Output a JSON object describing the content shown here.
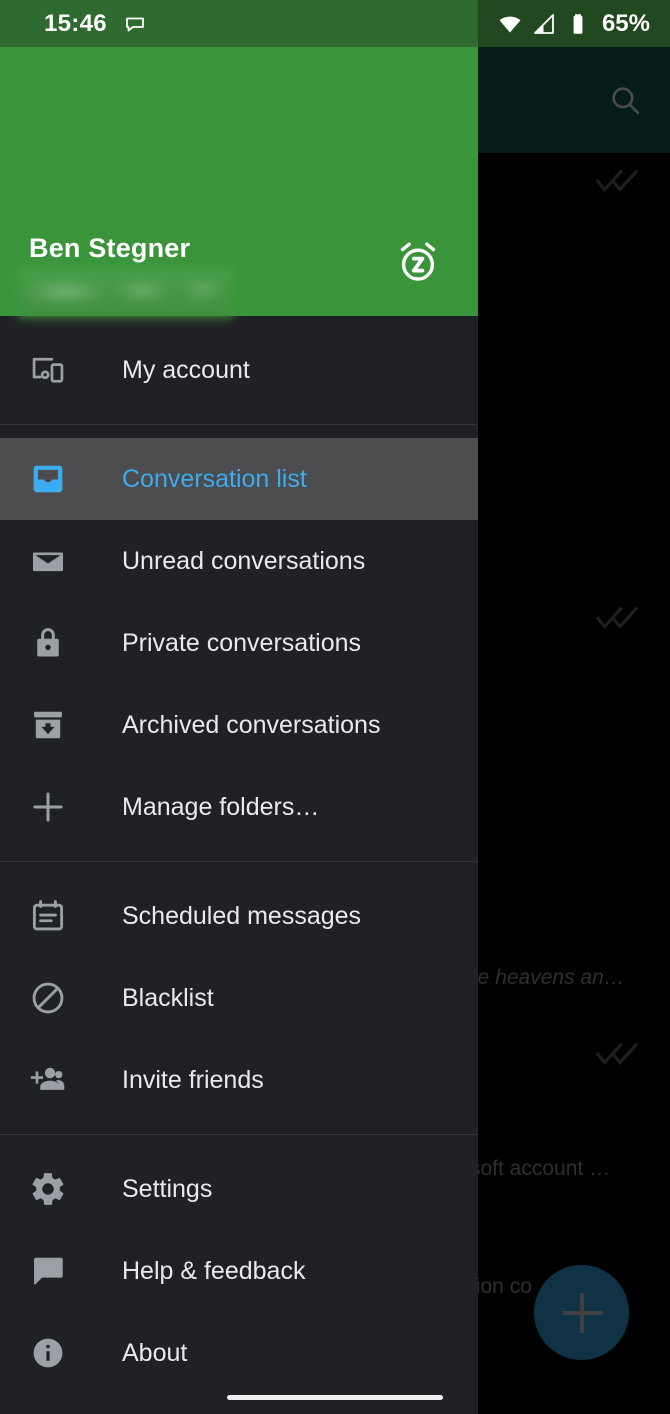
{
  "status_bar": {
    "time": "15:46",
    "battery_percent": "65%",
    "icons": [
      "message-bubble-icon",
      "wifi-icon",
      "cellular-signal-icon",
      "battery-icon"
    ]
  },
  "drawer": {
    "account": {
      "name": "Ben Stegner",
      "email_redacted": "",
      "snooze_label": "snooze-icon"
    },
    "accent_color": "#3cabf0",
    "header_color": "#3a953a",
    "background_color": "#202124",
    "selected_row_color": "#4c4c4e",
    "groups": [
      {
        "items": [
          {
            "label": "My account",
            "icon": "devices-icon",
            "selected": false
          }
        ]
      },
      {
        "items": [
          {
            "label": "Conversation list",
            "icon": "inbox-icon",
            "selected": true
          },
          {
            "label": "Unread conversations",
            "icon": "envelope-icon",
            "selected": false
          },
          {
            "label": "Private conversations",
            "icon": "lock-icon",
            "selected": false
          },
          {
            "label": "Archived conversations",
            "icon": "archive-icon",
            "selected": false
          },
          {
            "label": "Manage folders…",
            "icon": "plus-icon",
            "selected": false
          }
        ]
      },
      {
        "items": [
          {
            "label": "Scheduled messages",
            "icon": "calendar-icon",
            "selected": false
          },
          {
            "label": "Blacklist",
            "icon": "block-icon",
            "selected": false
          },
          {
            "label": "Invite friends",
            "icon": "person-add-icon",
            "selected": false
          }
        ]
      },
      {
        "items": [
          {
            "label": "Settings",
            "icon": "gear-icon",
            "selected": false
          },
          {
            "label": "Help & feedback",
            "icon": "feedback-icon",
            "selected": false
          },
          {
            "label": "About",
            "icon": "info-icon",
            "selected": false
          }
        ]
      }
    ]
  },
  "background_app": {
    "appbar_color": "#083631",
    "search_icon": "search-icon",
    "fab": {
      "icon": "plus-icon",
      "color": "#1d5e7c"
    },
    "snippets": [
      {
        "text": "he heavens an…",
        "italic": true
      },
      {
        "text": "soft account …",
        "italic": false
      },
      {
        "text": "tion co",
        "italic": false
      }
    ]
  }
}
